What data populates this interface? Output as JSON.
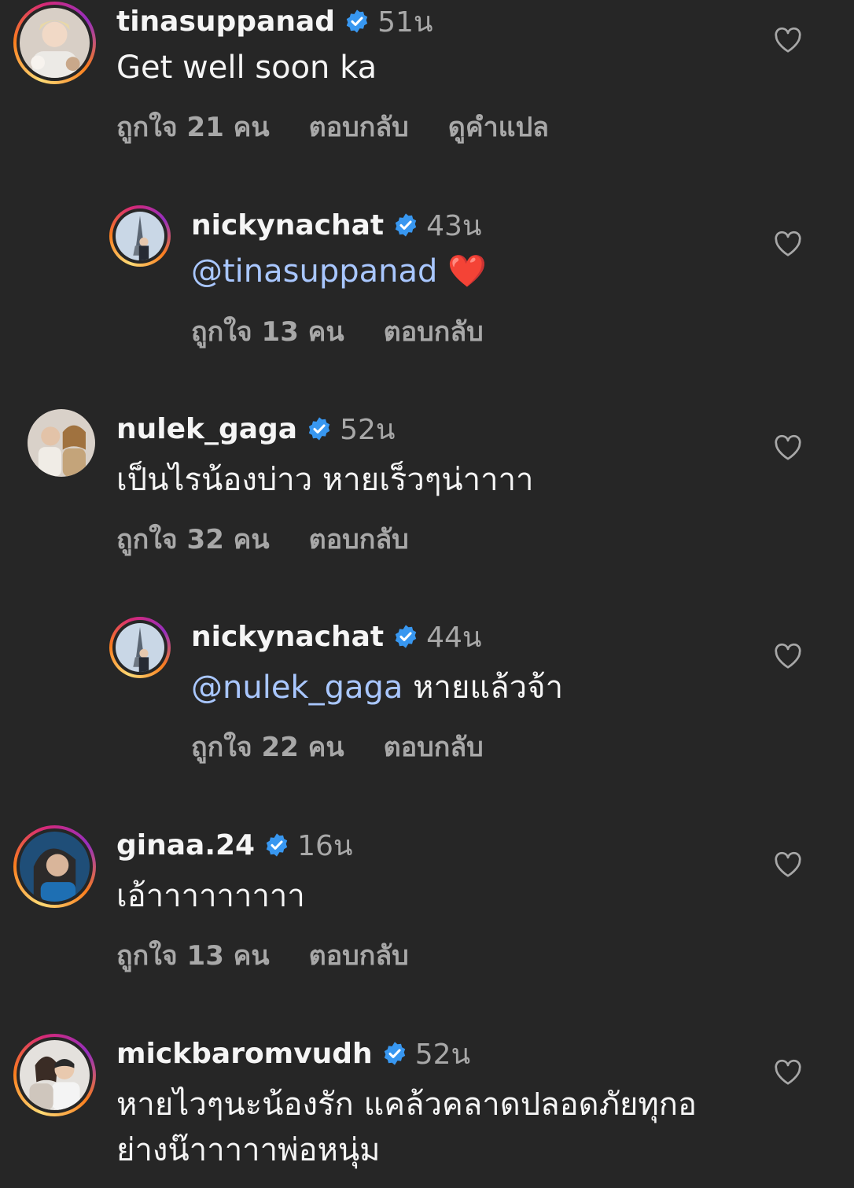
{
  "comments": [
    {
      "username": "tinasuppanad",
      "time": "51น",
      "text": "Get well soon ka",
      "likes": "ถูกใจ 21 คน",
      "reply": "ตอบกลับ",
      "translate": "ดูคำแปล"
    },
    {
      "username": "nickynachat",
      "time": "43น",
      "mention": "@tinasuppanad",
      "text": "❤️",
      "likes": "ถูกใจ 13 คน",
      "reply": "ตอบกลับ"
    },
    {
      "username": "nulek_gaga",
      "time": "52น",
      "text": "เป็นไรน้องบ่าว หายเร็วๆน่าาาา",
      "likes": "ถูกใจ 32 คน",
      "reply": "ตอบกลับ"
    },
    {
      "username": "nickynachat",
      "time": "44น",
      "mention": "@nulek_gaga",
      "text": "หายแล้วจ้า",
      "likes": "ถูกใจ 22 คน",
      "reply": "ตอบกลับ"
    },
    {
      "username": "ginaa.24",
      "time": "16น",
      "text": "เอ้าาาาาาาาา",
      "likes": "ถูกใจ 13 คน",
      "reply": "ตอบกลับ"
    },
    {
      "username": "mickbaromvudh",
      "time": "52น",
      "text_line1": "หายไวๆนะน้องรัก แคล้วคลาดปลอดภัยทุกอ",
      "text_line2": "ย่างน๊าาาาาพ่อหนุ่ม"
    }
  ],
  "colors": {
    "background": "#262626",
    "verified": "#3897f0",
    "mention": "#a9c7ff",
    "muted": "#a8a8a8"
  },
  "icons": {
    "verified": "verified-badge-icon",
    "like": "heart-outline-icon"
  }
}
